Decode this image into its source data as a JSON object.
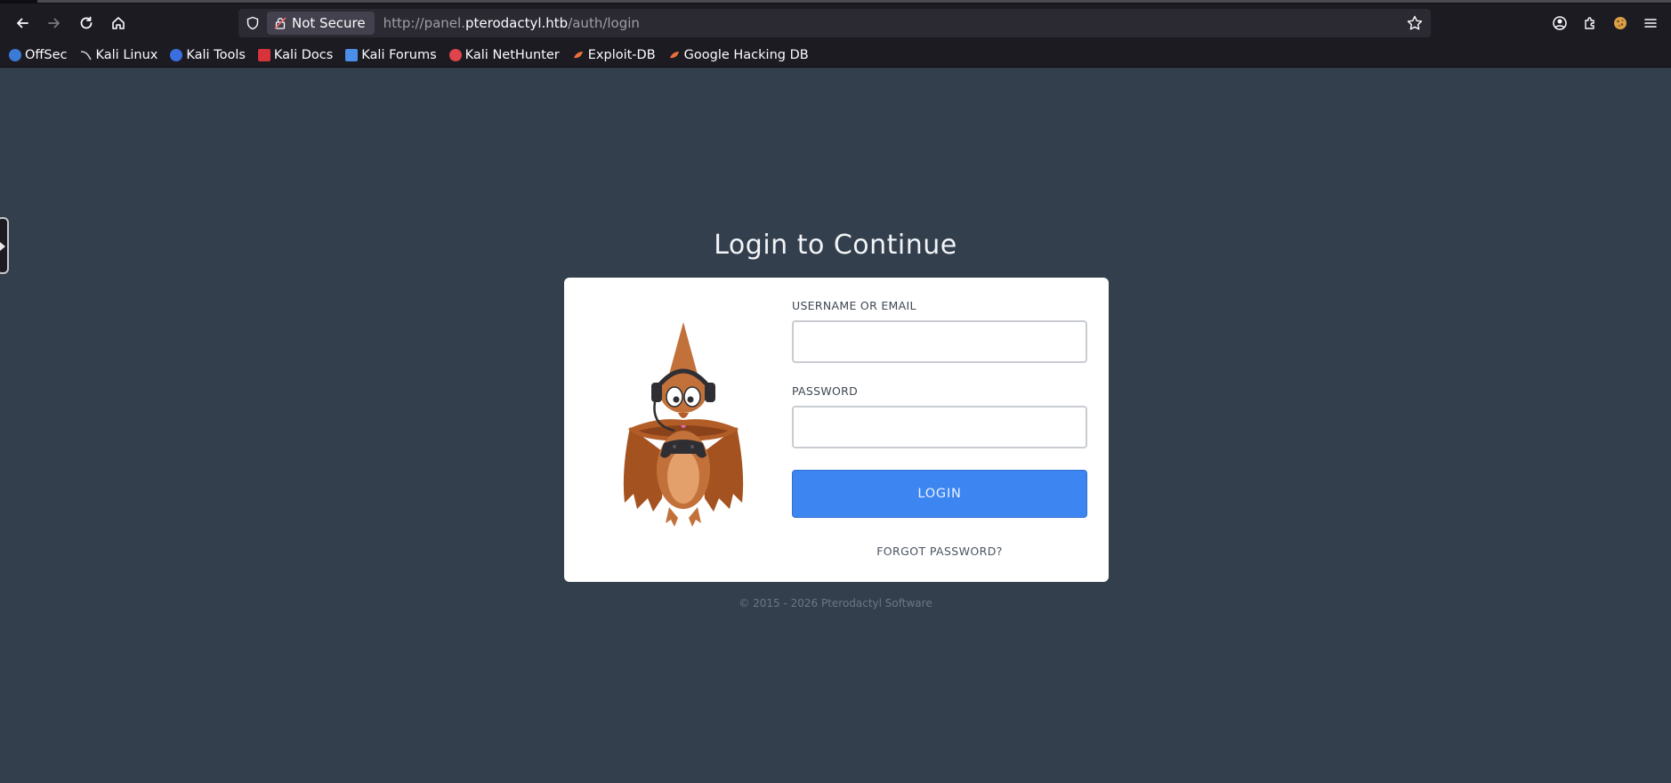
{
  "browser": {
    "security_label": "Not Secure",
    "url_prefix": "http://panel.",
    "url_host": "pterodactyl.htb",
    "url_path": "/auth/login",
    "icons": [
      "back-icon",
      "forward-icon",
      "reload-icon",
      "home-icon",
      "shield-icon",
      "lock-warning-icon",
      "bookmark-star-icon",
      "account-icon",
      "extensions-icon",
      "cookie-icon",
      "menu-icon"
    ]
  },
  "bookmarks": [
    {
      "label": "OffSec",
      "color": "#3a7bd5"
    },
    {
      "label": "Kali Linux",
      "color": "#cfd2d6"
    },
    {
      "label": "Kali Tools",
      "color": "#3b6fe0"
    },
    {
      "label": "Kali Docs",
      "color": "#d6333b"
    },
    {
      "label": "Kali Forums",
      "color": "#4b8fe8"
    },
    {
      "label": "Kali NetHunter",
      "color": "#e0434b"
    },
    {
      "label": "Exploit-DB",
      "color": "#e8703a"
    },
    {
      "label": "Google Hacking DB",
      "color": "#e8703a"
    }
  ],
  "page": {
    "title": "Login to Continue",
    "username_label": "USERNAME OR EMAIL",
    "username_value": "",
    "password_label": "PASSWORD",
    "password_value": "",
    "login_button": "LOGIN",
    "forgot_link": "FORGOT PASSWORD?",
    "copyright": "© 2015 - 2026 Pterodactyl Software",
    "accent_color": "#3d85f1",
    "background_color": "#333f4d"
  }
}
